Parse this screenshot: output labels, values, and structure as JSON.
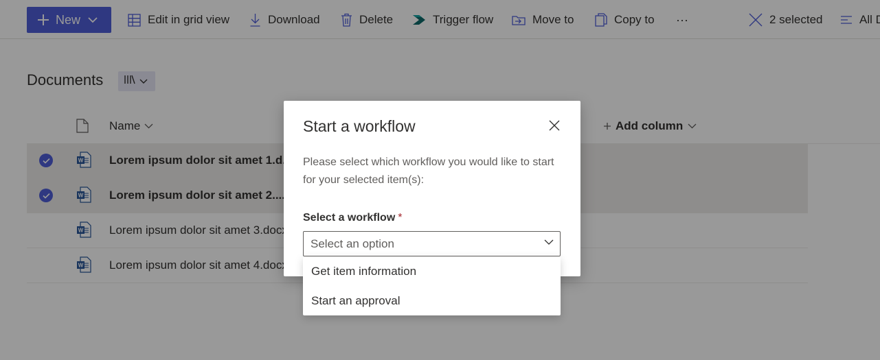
{
  "toolbar": {
    "new_label": "New",
    "edit_grid_label": "Edit in grid view",
    "download_label": "Download",
    "delete_label": "Delete",
    "trigger_flow_label": "Trigger flow",
    "move_to_label": "Move to",
    "copy_to_label": "Copy to",
    "more_label": "···",
    "selected_label": "2 selected",
    "all_label": "All D"
  },
  "library": {
    "title": "Documents",
    "columns": {
      "name": "Name",
      "add_column": "Add column"
    },
    "files": [
      {
        "name": "Lorem ipsum dolor sit amet 1.d...",
        "selected": true
      },
      {
        "name": "Lorem ipsum dolor sit amet 2....",
        "selected": true
      },
      {
        "name": "Lorem ipsum dolor sit amet 3.docx",
        "selected": false
      },
      {
        "name": "Lorem ipsum dolor sit amet 4.docx",
        "selected": false
      }
    ]
  },
  "dialog": {
    "title": "Start a workflow",
    "description": "Please select which workflow you would like to start for your selected item(s):",
    "field_label": "Select a workflow",
    "required_mark": "*",
    "dropdown_placeholder": "Select an option",
    "options": [
      "Get item information",
      "Start an approval"
    ]
  },
  "colors": {
    "accent": "#4f5ed8",
    "overlay": "rgba(0,0,0,0.4)",
    "required": "#a4262c",
    "selected_row": "#edebe9"
  },
  "icons": {
    "new": "plus-icon",
    "edit_grid": "grid-icon",
    "download": "download-icon",
    "delete": "trash-icon",
    "trigger_flow": "flow-icon",
    "move_to": "move-icon",
    "copy_to": "copy-icon",
    "selected_clear": "close-icon",
    "view": "library-view-icon",
    "file": "word-file-icon",
    "dialog_close": "close-icon",
    "dropdown": "chevron-down-icon"
  }
}
